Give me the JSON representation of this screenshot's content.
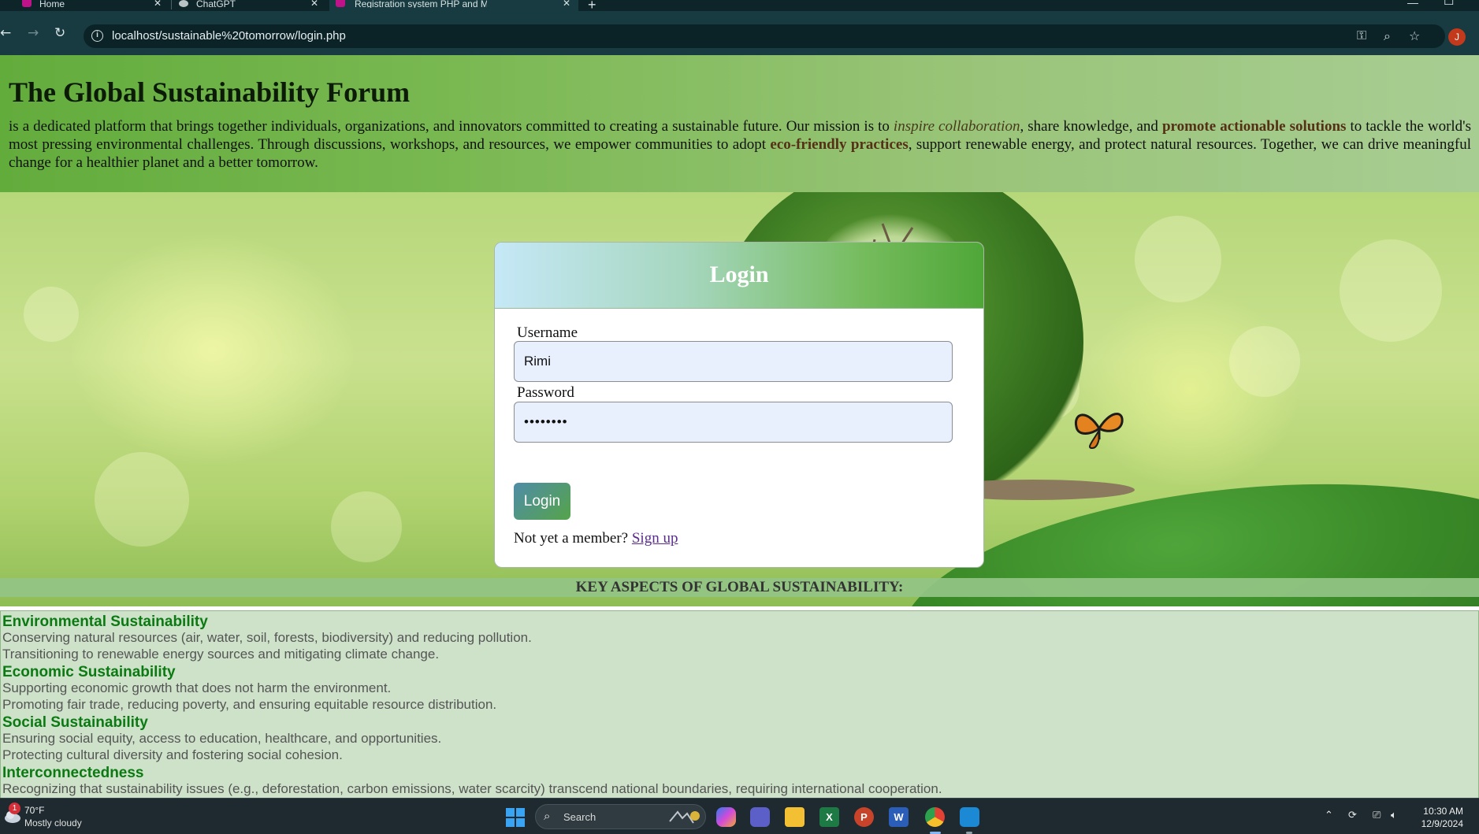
{
  "browser": {
    "tabs": [
      {
        "label": "Home",
        "favicon_color": "#c0138a"
      },
      {
        "label": "ChatGPT",
        "favicon_color": "#b9c3c6"
      },
      {
        "label": "Registration system PHP and M",
        "favicon_color": "#c0138a"
      }
    ],
    "close_glyph": "✕",
    "new_tab_glyph": "+",
    "url": "localhost/sustainable%20tomorrow/login.php",
    "profile_initial": "J"
  },
  "header": {
    "title": "The Global Sustainability Forum",
    "intro": {
      "p1": "is a dedicated platform that brings together individuals, organizations, and innovators committed to creating a sustainable future. Our mission is to ",
      "em1": "inspire collaboration",
      "p2": ", share knowledge, and ",
      "strong1": "promote actionable solutions",
      "p3": " to tackle the world's most pressing environmental challenges. Through discussions, workshops, and resources, we empower communities to adopt ",
      "strong2": "eco-friendly practices",
      "p4": ", support renewable energy, and protect natural resources. Together, we can drive meaningful change for a healthier planet and a better tomorrow."
    }
  },
  "login": {
    "title": "Login",
    "username_label": "Username",
    "username_value": "Rimi",
    "password_label": "Password",
    "password_value": "••••••••",
    "button_label": "Login",
    "member_prompt": "Not yet a member?",
    "signup_label": "Sign up"
  },
  "key_aspects": {
    "heading": "KEY ASPECTS OF GLOBAL SUSTAINABILITY:",
    "sections": [
      {
        "title": "Environmental Sustainability",
        "lines": [
          "Conserving natural resources (air, water, soil, forests, biodiversity) and reducing pollution.",
          "Transitioning to renewable energy sources and mitigating climate change."
        ]
      },
      {
        "title": "Economic Sustainability",
        "lines": [
          "Supporting economic growth that does not harm the environment.",
          "Promoting fair trade, reducing poverty, and ensuring equitable resource distribution."
        ]
      },
      {
        "title": "Social Sustainability",
        "lines": [
          "Ensuring social equity, access to education, healthcare, and opportunities.",
          "Protecting cultural diversity and fostering social cohesion."
        ]
      },
      {
        "title": "Interconnectedness",
        "lines": [
          "Recognizing that sustainability issues (e.g., deforestation, carbon emissions, water scarcity) transcend national boundaries, requiring international cooperation."
        ]
      }
    ]
  },
  "taskbar": {
    "weather_badge": "1",
    "temperature": "70°F",
    "condition": "Mostly cloudy",
    "search_label": "Search",
    "apps": [
      "copilot-app",
      "teams-app",
      "file-explorer-app",
      "excel-app",
      "powerpoint-app",
      "word-app",
      "chrome-app",
      "vscode-app"
    ],
    "app_letters": {
      "excel": "X",
      "powerpoint": "P",
      "word": "W"
    },
    "time": "10:30 AM",
    "date": "12/9/2024"
  },
  "colors": {
    "header_green": "#62ac3c",
    "aspect_title_green": "#0b7a12",
    "signup_link": "#5a2b8e"
  }
}
